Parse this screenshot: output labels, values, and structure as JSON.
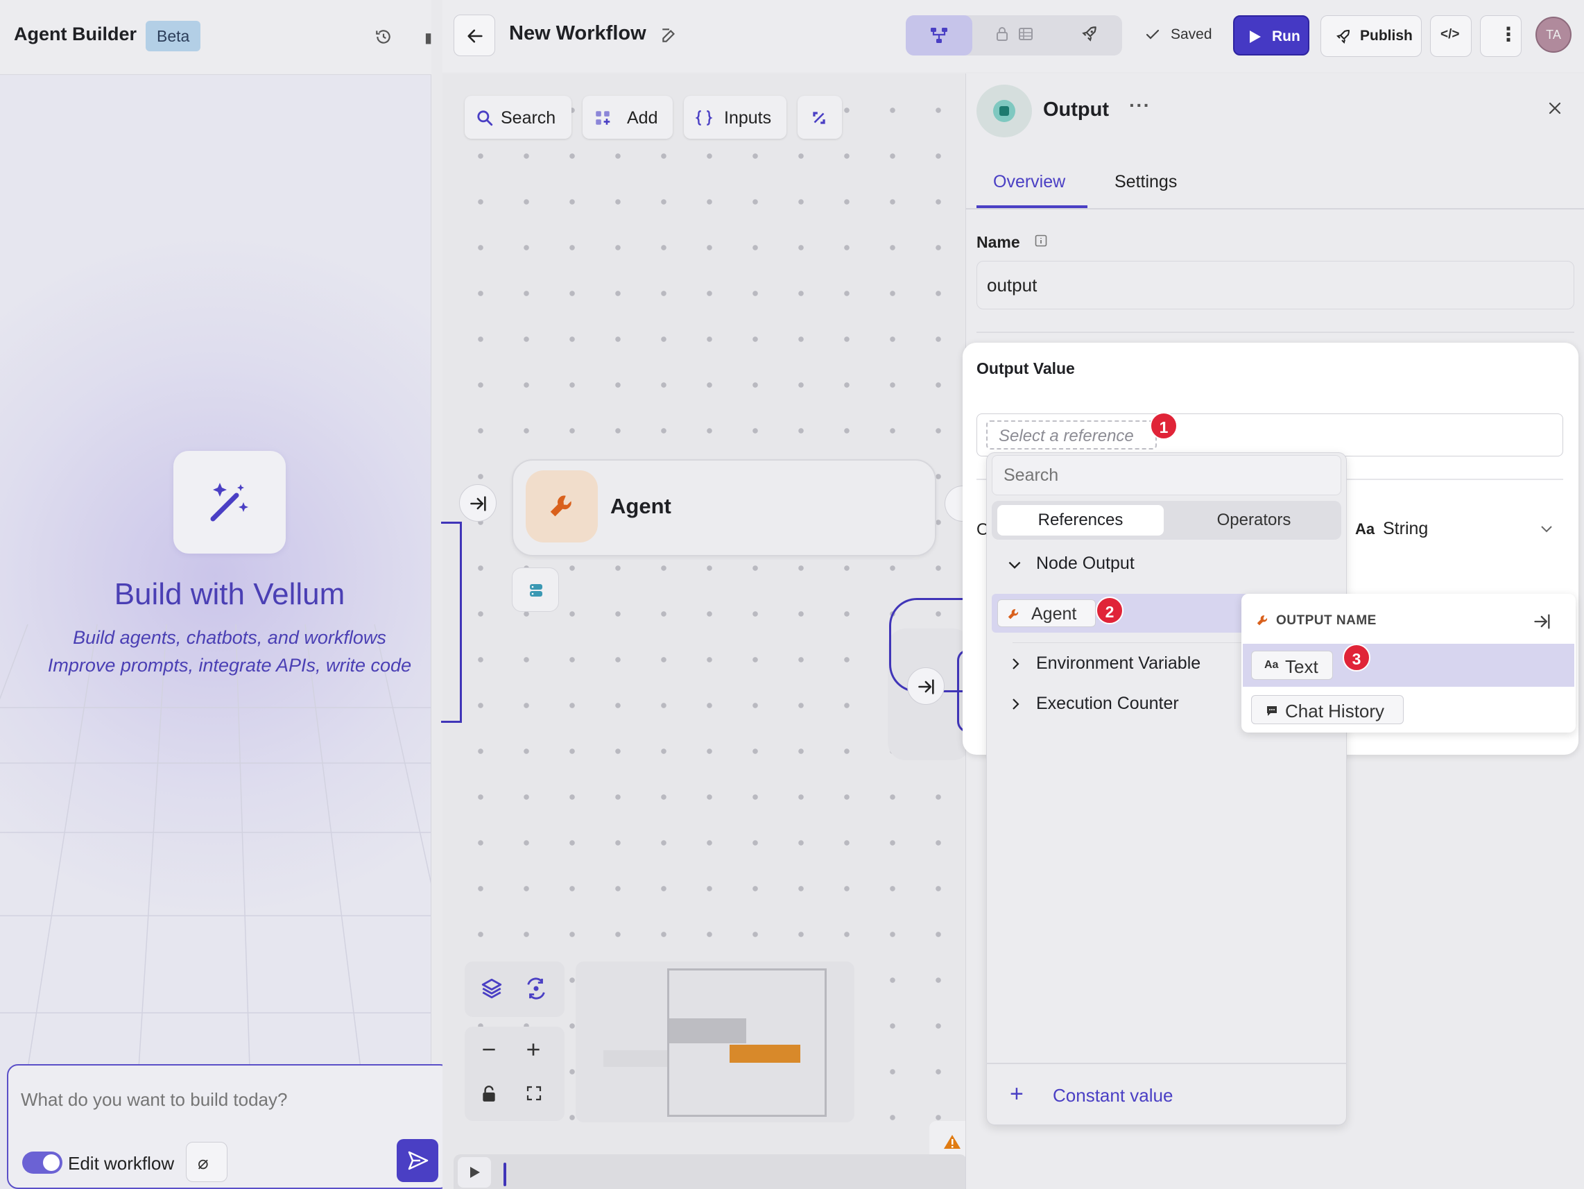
{
  "left_panel": {
    "app_title": "Agent Builder",
    "beta_badge": "Beta",
    "build_title": "Build with Vellum",
    "build_subtitle_1": "Build agents, chatbots, and workflows",
    "build_subtitle_2": "Improve prompts, integrate APIs, write code",
    "chat_placeholder": "What do you want to build today?",
    "edit_toggle_label": "Edit workflow",
    "edit_toggle_on": true
  },
  "header": {
    "workflow_title": "New Workflow",
    "saved_label": "Saved",
    "run_label": "Run",
    "publish_label": "Publish",
    "code_label": "</>",
    "more_label": "⋮",
    "avatar_initials": "TA",
    "accent_color": "#4539c4"
  },
  "canvas": {
    "toolbar": {
      "search_label": "Search",
      "add_label": "Add",
      "inputs_label": "Inputs"
    },
    "nodes": {
      "agent_label": "Agent"
    }
  },
  "right_panel": {
    "node_title": "Output",
    "more_label": "···",
    "tabs": [
      {
        "label": "Overview",
        "active": true
      },
      {
        "label": "Settings",
        "active": false
      }
    ],
    "name_label": "Name",
    "name_value": "output",
    "output_value_label": "Output Value",
    "reference_placeholder": "Select a reference",
    "type_label": "String",
    "type_icon": "Aa",
    "c_stub": "O",
    "dropdown": {
      "search_placeholder": "Search",
      "segments": [
        "References",
        "Operators"
      ],
      "groups": {
        "node_output": "Node Output",
        "environment_variable": "Environment Variable",
        "execution_counter": "Execution Counter"
      },
      "agent_item": "Agent",
      "constant_value_label": "Constant value"
    },
    "submenu": {
      "header": "OUTPUT NAME",
      "items": [
        {
          "icon": "Aa",
          "label": "Text"
        },
        {
          "icon": "chat-icon",
          "label": "Chat History"
        }
      ]
    },
    "step_badges": [
      "1",
      "2",
      "3"
    ]
  }
}
